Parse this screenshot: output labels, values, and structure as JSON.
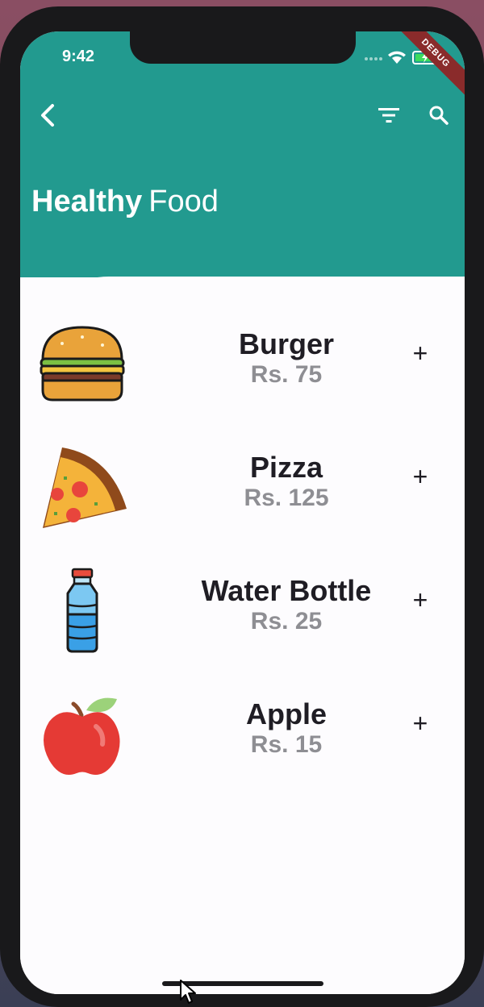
{
  "status_bar": {
    "time": "9:42",
    "debug_label": "DEBUG"
  },
  "header": {
    "title_bold": "Healthy",
    "title_light": "Food",
    "back_icon": "chevron-left-icon",
    "filter_icon": "filter-icon",
    "search_icon": "search-icon"
  },
  "items": [
    {
      "name": "Burger",
      "price": "Rs. 75",
      "icon": "burger-icon"
    },
    {
      "name": "Pizza",
      "price": "Rs. 125",
      "icon": "pizza-icon"
    },
    {
      "name": "Water Bottle",
      "price": "Rs. 25",
      "icon": "water-bottle-icon"
    },
    {
      "name": "Apple",
      "price": "Rs. 15",
      "icon": "apple-icon"
    }
  ],
  "add_symbol": "+",
  "colors": {
    "primary": "#229a8f",
    "text": "#1f1d24",
    "price": "#8e8e93",
    "debug": "#8a2b2b"
  }
}
